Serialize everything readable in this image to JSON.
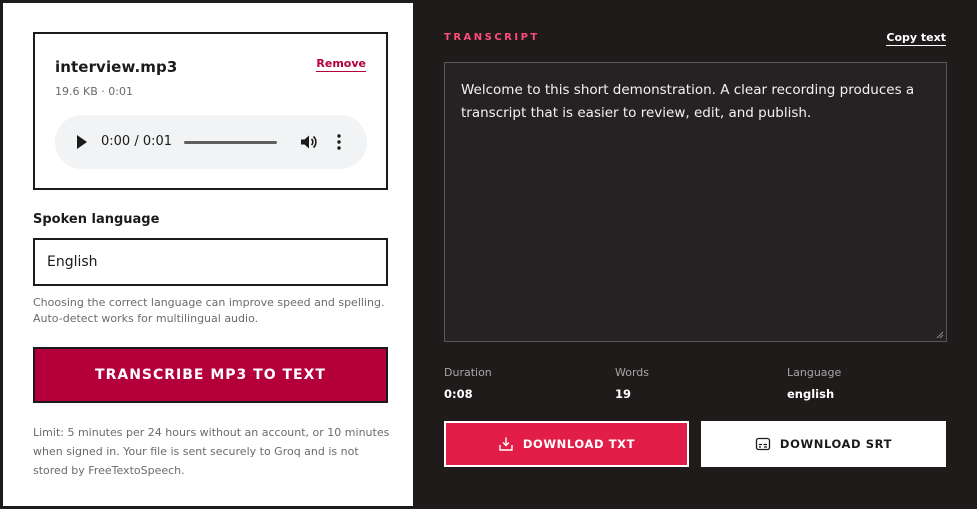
{
  "file": {
    "name": "interview.mp3",
    "meta": "19.6 KB · 0:01",
    "remove_label": "Remove"
  },
  "player": {
    "time": "0:00 / 0:01"
  },
  "language": {
    "label": "Spoken language",
    "selected": "English",
    "hint": "Choosing the correct language can improve speed and spelling. Auto-detect works for multilingual audio."
  },
  "transcribe_label": "TRANSCRIBE MP3 TO TEXT",
  "limit_text": "Limit: 5 minutes per 24 hours without an account, or 10 minutes when signed in. Your file is sent securely to Groq and is not stored by FreeTextoSpeech.",
  "transcript": {
    "label": "TRANSCRIPT",
    "copy_label": "Copy text",
    "text": "Welcome to this short demonstration. A clear recording produces a transcript that is easier to review, edit, and publish."
  },
  "stats": {
    "duration_label": "Duration",
    "duration_value": "0:08",
    "words_label": "Words",
    "words_value": "19",
    "language_label": "Language",
    "language_value": "english"
  },
  "downloads": {
    "txt_label": "DOWNLOAD TXT",
    "srt_label": "DOWNLOAD SRT"
  },
  "colors": {
    "accent_dark": "#b4003a",
    "accent_bright": "#e11d48",
    "label_pink": "#ff4d7a",
    "panel_dark": "#1f1b1b"
  }
}
